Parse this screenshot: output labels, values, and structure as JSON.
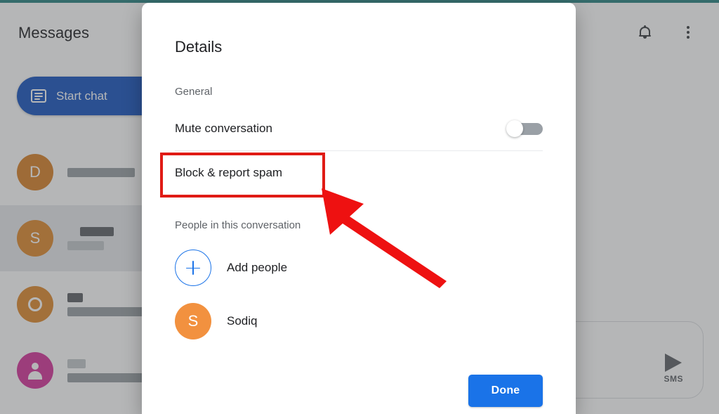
{
  "app": {
    "title": "Messages",
    "header_icons": [
      {
        "name": "notifications-bell-icon",
        "label": "Notifications"
      },
      {
        "name": "more-options-kebab-icon",
        "label": "More options"
      }
    ]
  },
  "sidebar": {
    "start_chat_label": "Start chat",
    "start_chat_icon": "compose-message-icon",
    "conversations": [
      {
        "initial": "D",
        "avatar_color": "#d9822b",
        "avatar_type": "letter",
        "selected": false
      },
      {
        "initial": "S",
        "avatar_color": "#e08a30",
        "avatar_type": "letter",
        "selected": true
      },
      {
        "initial": "O",
        "avatar_color": "#e08a30",
        "avatar_type": "ring",
        "selected": false
      },
      {
        "initial": "",
        "avatar_color": "#d6369c",
        "avatar_type": "person",
        "selected": false
      }
    ]
  },
  "composer": {
    "send_label": "SMS",
    "send_icon": "send-arrow-icon"
  },
  "dialog": {
    "title": "Details",
    "general_label": "General",
    "mute_label": "Mute conversation",
    "mute_enabled": false,
    "block_report_label": "Block & report spam",
    "people_label": "People in this conversation",
    "add_people_label": "Add people",
    "add_people_icon": "plus-circle-icon",
    "participants": [
      {
        "name": "Sodiq",
        "initial": "S",
        "avatar_color": "#f2913f"
      }
    ],
    "done_label": "Done"
  },
  "annotation": {
    "highlight_target": "Block & report spam",
    "color": "#e01b15",
    "arrow_icon": "pointer-arrow-icon"
  },
  "colors": {
    "accent_blue": "#1a73e8",
    "start_chat_blue": "#1a56c0",
    "annotation_red": "#e01b15",
    "top_strip_teal": "#356b6b",
    "scrim": "rgba(70,72,74,0.40)"
  }
}
